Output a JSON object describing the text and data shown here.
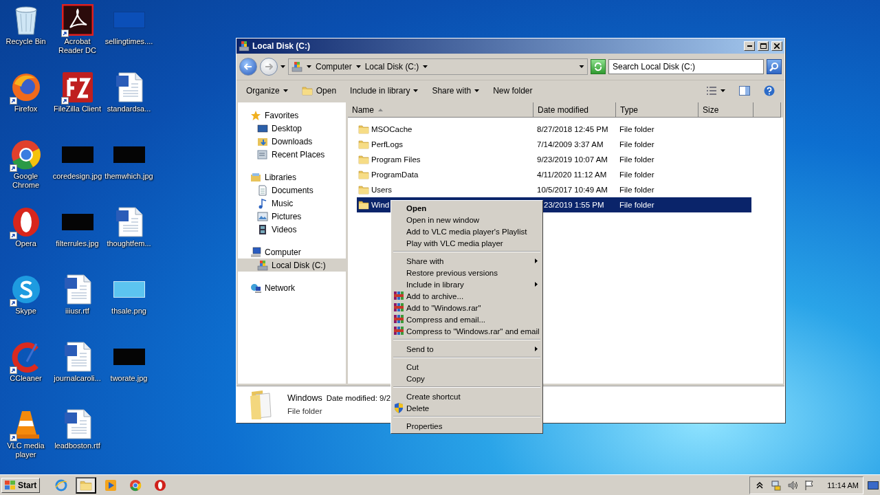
{
  "desktop_icons": [
    {
      "label": "Recycle Bin",
      "kind": "recycle",
      "shortcut": false
    },
    {
      "label": "Acrobat Reader DC",
      "kind": "acrobat",
      "shortcut": true
    },
    {
      "label": "sellingtimes....",
      "kind": "thumb-blue",
      "shortcut": false
    },
    {
      "label": "Firefox",
      "kind": "firefox",
      "shortcut": true
    },
    {
      "label": "FileZilla Client",
      "kind": "filezilla",
      "shortcut": true
    },
    {
      "label": "standardsa...",
      "kind": "word",
      "shortcut": false
    },
    {
      "label": "Google Chrome",
      "kind": "chrome",
      "shortcut": true
    },
    {
      "label": "coredesign.jpg",
      "kind": "thumb-black",
      "shortcut": false
    },
    {
      "label": "themwhich.jpg",
      "kind": "thumb-black",
      "shortcut": false
    },
    {
      "label": "Opera",
      "kind": "opera",
      "shortcut": true
    },
    {
      "label": "filterrules.jpg",
      "kind": "thumb-black",
      "shortcut": false
    },
    {
      "label": "thoughtfem...",
      "kind": "word",
      "shortcut": false
    },
    {
      "label": "Skype",
      "kind": "skype",
      "shortcut": true
    },
    {
      "label": "iiiusr.rtf",
      "kind": "word",
      "shortcut": false
    },
    {
      "label": "thsale.png",
      "kind": "thumb-light",
      "shortcut": false
    },
    {
      "label": "CCleaner",
      "kind": "ccleaner",
      "shortcut": true
    },
    {
      "label": "journalcaroli...",
      "kind": "word",
      "shortcut": false
    },
    {
      "label": "tworate.jpg",
      "kind": "thumb-black",
      "shortcut": false
    },
    {
      "label": "VLC media player",
      "kind": "vlc",
      "shortcut": true
    },
    {
      "label": "leadboston.rtf",
      "kind": "word",
      "shortcut": false
    }
  ],
  "window": {
    "title": "Local Disk (C:)",
    "address": {
      "crumbs": [
        "Computer",
        "Local Disk (C:)"
      ]
    },
    "search": {
      "placeholder": "Search Local Disk (C:)"
    },
    "toolbar": [
      {
        "label": "Organize",
        "kind": "menu"
      },
      {
        "label": "Open",
        "kind": "open"
      },
      {
        "label": "Include in library",
        "kind": "menu"
      },
      {
        "label": "Share with",
        "kind": "menu"
      },
      {
        "label": "New folder",
        "kind": "plain"
      }
    ],
    "sidebar": [
      {
        "label": "Favorites",
        "kind": "star",
        "selected": false,
        "children": [
          {
            "label": "Desktop",
            "kind": "desktop",
            "selected": false
          },
          {
            "label": "Downloads",
            "kind": "downloads",
            "selected": false
          },
          {
            "label": "Recent Places",
            "kind": "recent",
            "selected": false
          }
        ]
      },
      {
        "label": "Libraries",
        "kind": "libraries",
        "selected": false,
        "children": [
          {
            "label": "Documents",
            "kind": "documents",
            "selected": false
          },
          {
            "label": "Music",
            "kind": "music",
            "selected": false
          },
          {
            "label": "Pictures",
            "kind": "pictures",
            "selected": false
          },
          {
            "label": "Videos",
            "kind": "videos",
            "selected": false
          }
        ]
      },
      {
        "label": "Computer",
        "kind": "computer",
        "selected": false,
        "children": [
          {
            "label": "Local Disk (C:)",
            "kind": "drive",
            "selected": true
          }
        ]
      },
      {
        "label": "Network",
        "kind": "network",
        "selected": false
      }
    ],
    "columns": [
      {
        "label": "Name",
        "sorted": true
      },
      {
        "label": "Date modified",
        "sorted": false
      },
      {
        "label": "Type",
        "sorted": false
      },
      {
        "label": "Size",
        "sorted": false
      }
    ],
    "rows": [
      {
        "name": "MSOCache",
        "date": "8/27/2018 12:45 PM",
        "type": "File folder",
        "selected": false
      },
      {
        "name": "PerfLogs",
        "date": "7/14/2009 3:37 AM",
        "type": "File folder",
        "selected": false
      },
      {
        "name": "Program Files",
        "date": "9/23/2019 10:07 AM",
        "type": "File folder",
        "selected": false
      },
      {
        "name": "ProgramData",
        "date": "4/11/2020 11:12 AM",
        "type": "File folder",
        "selected": false
      },
      {
        "name": "Users",
        "date": "10/5/2017 10:49 AM",
        "type": "File folder",
        "selected": false
      },
      {
        "name": "Wind",
        "date": "23/2019 1:55 PM",
        "type": "File folder",
        "selected": true
      }
    ],
    "details": {
      "name": "Windows",
      "date": "Date modified: 9/2",
      "type": "File folder"
    }
  },
  "context_menu": {
    "sections": [
      [
        {
          "label": "Open",
          "kind": "plain",
          "default": true,
          "submenu": false
        },
        {
          "label": "Open in new window",
          "kind": "plain",
          "default": false,
          "submenu": false
        },
        {
          "label": "Add to VLC media player's Playlist",
          "kind": "plain",
          "default": false,
          "submenu": false
        },
        {
          "label": "Play with VLC media player",
          "kind": "plain",
          "default": false,
          "submenu": false
        }
      ],
      [
        {
          "label": "Share with",
          "kind": "plain",
          "default": false,
          "submenu": true
        },
        {
          "label": "Restore previous versions",
          "kind": "plain",
          "default": false,
          "submenu": false
        },
        {
          "label": "Include in library",
          "kind": "plain",
          "default": false,
          "submenu": true
        },
        {
          "label": "Add to archive...",
          "kind": "archive",
          "default": false,
          "submenu": false
        },
        {
          "label": "Add to \"Windows.rar\"",
          "kind": "archive",
          "default": false,
          "submenu": false
        },
        {
          "label": "Compress and email...",
          "kind": "archive",
          "default": false,
          "submenu": false
        },
        {
          "label": "Compress to \"Windows.rar\" and email",
          "kind": "archive",
          "default": false,
          "submenu": false
        }
      ],
      [
        {
          "label": "Send to",
          "kind": "plain",
          "default": false,
          "submenu": true
        }
      ],
      [
        {
          "label": "Cut",
          "kind": "plain",
          "default": false,
          "submenu": false
        },
        {
          "label": "Copy",
          "kind": "plain",
          "default": false,
          "submenu": false
        }
      ],
      [
        {
          "label": "Create shortcut",
          "kind": "plain",
          "default": false,
          "submenu": false
        },
        {
          "label": "Delete",
          "kind": "shield",
          "default": false,
          "submenu": false
        }
      ],
      [
        {
          "label": "Properties",
          "kind": "plain",
          "default": false,
          "submenu": false
        }
      ]
    ]
  },
  "taskbar": {
    "start": "Start",
    "apps": [
      {
        "kind": "ie",
        "selected": false
      },
      {
        "kind": "explorer",
        "selected": true
      },
      {
        "kind": "media",
        "selected": false
      },
      {
        "kind": "chrome",
        "selected": false
      },
      {
        "kind": "opera",
        "selected": false
      }
    ],
    "tray": [
      {
        "kind": "chevron"
      },
      {
        "kind": "network"
      },
      {
        "kind": "volume"
      },
      {
        "kind": "flag"
      }
    ],
    "clock": "11:14 AM"
  }
}
